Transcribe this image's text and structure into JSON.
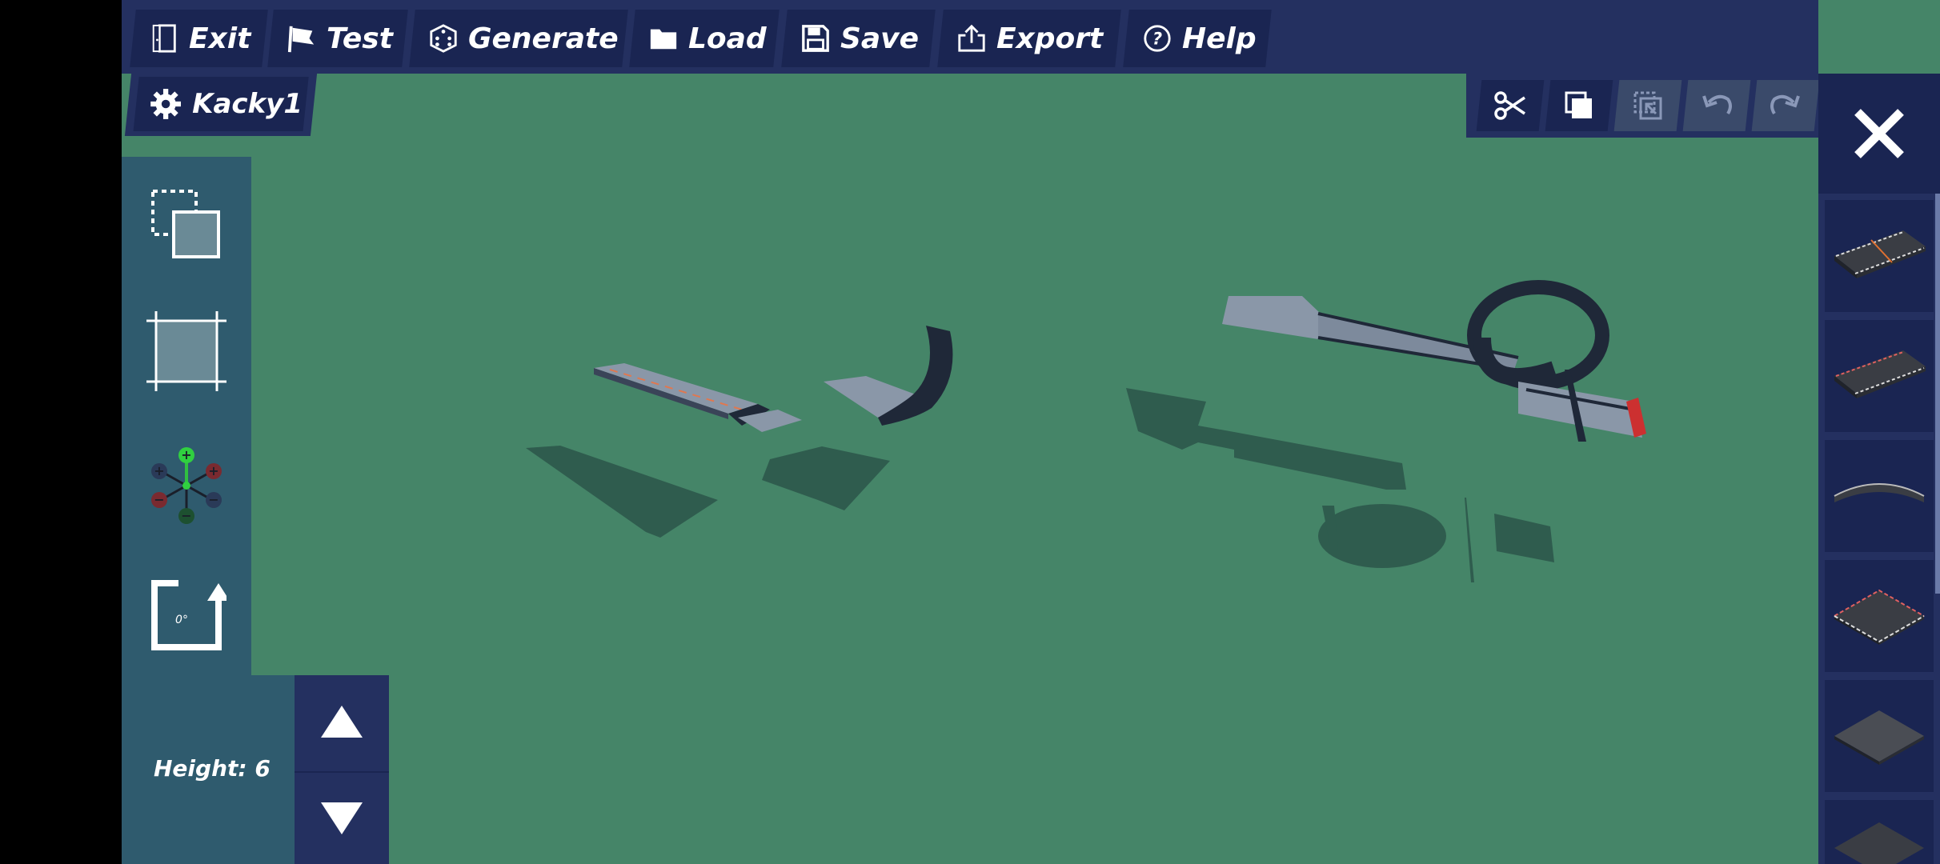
{
  "toolbar": {
    "exit": "Exit",
    "test": "Test",
    "generate": "Generate",
    "load": "Load",
    "save": "Save",
    "export": "Export",
    "help": "Help"
  },
  "map": {
    "name": "Kacky1"
  },
  "height": {
    "label": "Height: 6"
  },
  "tools": {
    "rotate_label": "0°"
  },
  "icons": {
    "exit": "door-icon",
    "test": "flag-icon",
    "generate": "dice-icon",
    "load": "folder-icon",
    "save": "floppy-icon",
    "export": "share-icon",
    "help": "help-icon",
    "settings": "gear-icon",
    "cut": "scissors-icon",
    "copy": "copy-icon",
    "paste": "paste-icon",
    "undo": "undo-icon",
    "redo": "redo-icon",
    "close": "close-icon"
  },
  "colors": {
    "bar": "#243060",
    "button": "#1a2552",
    "panel": "#2f5b6e",
    "ground": "#458568"
  }
}
